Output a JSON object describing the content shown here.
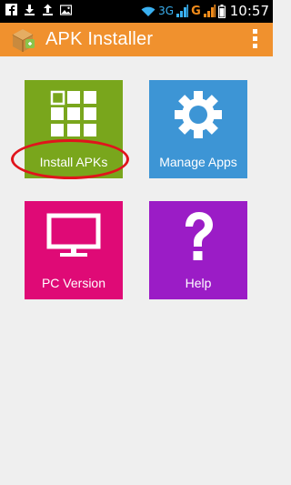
{
  "status_bar": {
    "network_label": "3G",
    "carrier_label": "G",
    "time": "10:57"
  },
  "app_bar": {
    "title": "APK Installer",
    "logo_icon": "apk-installer-logo-icon",
    "menu_icon": "overflow-menu-icon"
  },
  "tiles": [
    {
      "label": "Install APKs",
      "icon": "grid-icon",
      "color": "#79a61c"
    },
    {
      "label": "Manage Apps",
      "icon": "gear-icon",
      "color": "#3d95d5"
    },
    {
      "label": "PC Version",
      "icon": "monitor-icon",
      "color": "#df0a76"
    },
    {
      "label": "Help",
      "icon": "question-mark-icon",
      "color": "#9b1cc6"
    }
  ],
  "colors": {
    "app_bar": "#f0912e",
    "background": "#efefef",
    "annotation": "#e0141c"
  }
}
